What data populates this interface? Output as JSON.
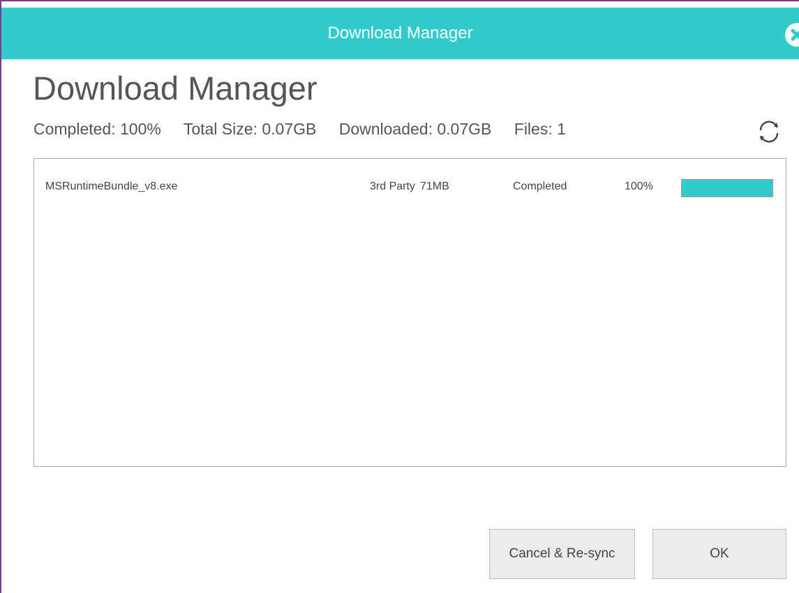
{
  "window": {
    "title": "Download Manager"
  },
  "header": {
    "heading": "Download Manager",
    "stats": {
      "completed": "Completed: 100%",
      "total_size": "Total Size: 0.07GB",
      "downloaded": "Downloaded: 0.07GB",
      "files": "Files: 1"
    },
    "refresh_icon": "refresh-icon"
  },
  "downloads": [
    {
      "name": "MSRuntimeBundle_v8.exe",
      "source": "3rd Party",
      "size": "71MB",
      "status": "Completed",
      "percent": "100%",
      "progress": 1.0
    }
  ],
  "buttons": {
    "cancel_label": "Cancel & Re-sync",
    "ok_label": "OK"
  },
  "colors": {
    "accent": "#31cbcb",
    "window_border": "#7a3e91",
    "text": "#555555"
  }
}
